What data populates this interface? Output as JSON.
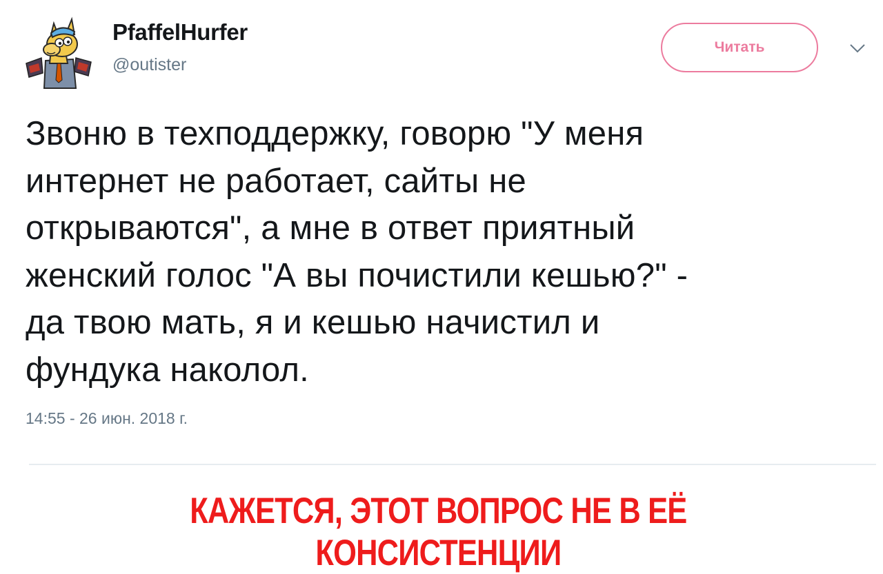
{
  "tweet": {
    "author": {
      "display_name": "PfaffelHurfer",
      "handle": "@outister",
      "avatar_icon": "cartoon-llama-avatar-icon"
    },
    "follow_button_label": "Читать",
    "menu_icon": "chevron-down-icon",
    "text": "Звоню в техподдержку, говорю \"У меня\nинтернет не работает, сайты не\nоткрываются\", а мне в ответ приятный\nженский голос \"А вы почистили кешью?\" -\nда твою мать, я и кешью начистил и\nфундука наколол.",
    "timestamp": "14:55 - 26 июн. 2018 г."
  },
  "caption": "КАЖЕТСЯ, ЭТОТ ВОПРОС НЕ В ЕЁ КОНСИСТЕНЦИИ",
  "colors": {
    "text": "#14171a",
    "secondary_text": "#657786",
    "follow_accent": "#e0245e",
    "caption_red": "#ee1c1c",
    "divider": "#e6ecf0"
  }
}
